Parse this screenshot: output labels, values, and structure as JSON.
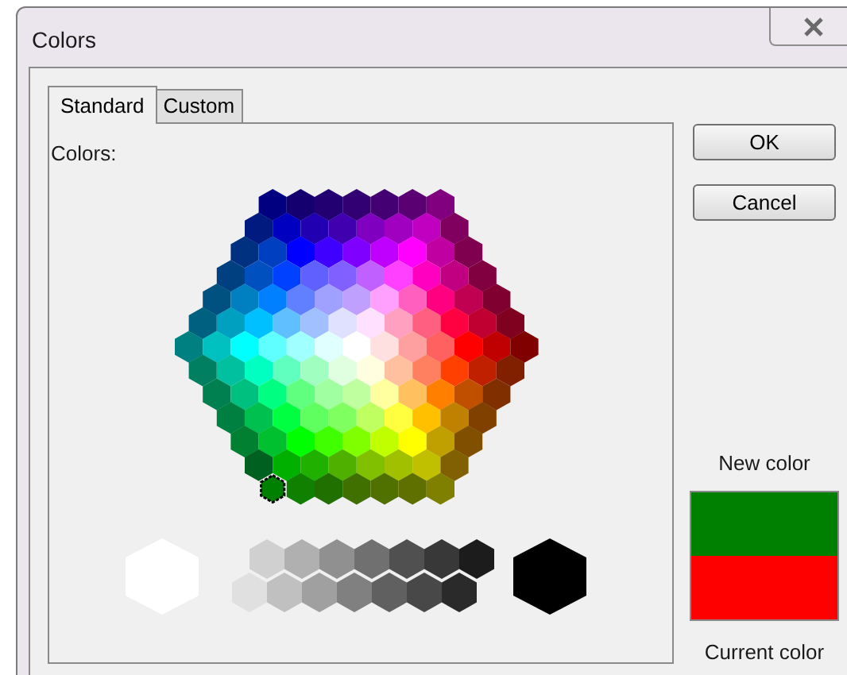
{
  "window": {
    "title": "Colors"
  },
  "tabs": [
    {
      "label": "Standard",
      "selected": true
    },
    {
      "label": "Custom",
      "selected": false
    }
  ],
  "colors_label": "Colors:",
  "palette": [
    [
      {
        "color": "#000080",
        "selected": false
      },
      {
        "color": "#14006e",
        "selected": false
      },
      {
        "color": "#220072",
        "selected": false
      },
      {
        "color": "#330073",
        "selected": false
      },
      {
        "color": "#440073",
        "selected": false
      },
      {
        "color": "#5a0073",
        "selected": false
      },
      {
        "color": "#800080",
        "selected": false
      }
    ],
    [
      {
        "color": "#001a80",
        "selected": false
      },
      {
        "color": "#0000c0",
        "selected": false
      },
      {
        "color": "#2000b0",
        "selected": false
      },
      {
        "color": "#4000b0",
        "selected": false
      },
      {
        "color": "#8000c0",
        "selected": false
      },
      {
        "color": "#a000c0",
        "selected": false
      },
      {
        "color": "#c000c0",
        "selected": false
      },
      {
        "color": "#800060",
        "selected": false
      }
    ],
    [
      {
        "color": "#003080",
        "selected": false
      },
      {
        "color": "#0040c0",
        "selected": false
      },
      {
        "color": "#0000ff",
        "selected": false
      },
      {
        "color": "#4000ff",
        "selected": false
      },
      {
        "color": "#8000ff",
        "selected": false
      },
      {
        "color": "#c000ff",
        "selected": false
      },
      {
        "color": "#ff00ff",
        "selected": false
      },
      {
        "color": "#c000a0",
        "selected": false
      },
      {
        "color": "#800050",
        "selected": false
      }
    ],
    [
      {
        "color": "#004080",
        "selected": false
      },
      {
        "color": "#0050c0",
        "selected": false
      },
      {
        "color": "#0040ff",
        "selected": false
      },
      {
        "color": "#6060ff",
        "selected": false
      },
      {
        "color": "#8060ff",
        "selected": false
      },
      {
        "color": "#c060ff",
        "selected": false
      },
      {
        "color": "#ff40ff",
        "selected": false
      },
      {
        "color": "#ff00c0",
        "selected": false
      },
      {
        "color": "#c00080",
        "selected": false
      },
      {
        "color": "#800040",
        "selected": false
      }
    ],
    [
      {
        "color": "#005080",
        "selected": false
      },
      {
        "color": "#0080c0",
        "selected": false
      },
      {
        "color": "#0080ff",
        "selected": false
      },
      {
        "color": "#6080ff",
        "selected": false
      },
      {
        "color": "#a0a0ff",
        "selected": false
      },
      {
        "color": "#c0a0ff",
        "selected": false
      },
      {
        "color": "#ffa0ff",
        "selected": false
      },
      {
        "color": "#ff60c0",
        "selected": false
      },
      {
        "color": "#ff0080",
        "selected": false
      },
      {
        "color": "#c00050",
        "selected": false
      },
      {
        "color": "#800030",
        "selected": false
      }
    ],
    [
      {
        "color": "#006080",
        "selected": false
      },
      {
        "color": "#00a0c0",
        "selected": false
      },
      {
        "color": "#00c0ff",
        "selected": false
      },
      {
        "color": "#60c0ff",
        "selected": false
      },
      {
        "color": "#a0c0ff",
        "selected": false
      },
      {
        "color": "#e0e0ff",
        "selected": false
      },
      {
        "color": "#ffe0ff",
        "selected": false
      },
      {
        "color": "#ffa0c0",
        "selected": false
      },
      {
        "color": "#ff6080",
        "selected": false
      },
      {
        "color": "#ff0040",
        "selected": false
      },
      {
        "color": "#c00030",
        "selected": false
      },
      {
        "color": "#800020",
        "selected": false
      }
    ],
    [
      {
        "color": "#008080",
        "selected": false
      },
      {
        "color": "#00c0c0",
        "selected": false
      },
      {
        "color": "#00ffff",
        "selected": false
      },
      {
        "color": "#60ffff",
        "selected": false
      },
      {
        "color": "#a0ffff",
        "selected": false
      },
      {
        "color": "#e0ffff",
        "selected": false
      },
      {
        "color": "#ffffff",
        "selected": false
      },
      {
        "color": "#ffe0e0",
        "selected": false
      },
      {
        "color": "#ffa0a0",
        "selected": false
      },
      {
        "color": "#ff6060",
        "selected": false
      },
      {
        "color": "#ff0000",
        "selected": false
      },
      {
        "color": "#c00000",
        "selected": false
      },
      {
        "color": "#800000",
        "selected": false
      }
    ],
    [
      {
        "color": "#008060",
        "selected": false
      },
      {
        "color": "#00c0a0",
        "selected": false
      },
      {
        "color": "#00ffc0",
        "selected": false
      },
      {
        "color": "#60ffc0",
        "selected": false
      },
      {
        "color": "#a0ffc0",
        "selected": false
      },
      {
        "color": "#e0ffe0",
        "selected": false
      },
      {
        "color": "#ffffe0",
        "selected": false
      },
      {
        "color": "#ffc0a0",
        "selected": false
      },
      {
        "color": "#ff8060",
        "selected": false
      },
      {
        "color": "#ff4000",
        "selected": false
      },
      {
        "color": "#c02000",
        "selected": false
      },
      {
        "color": "#802000",
        "selected": false
      }
    ],
    [
      {
        "color": "#008050",
        "selected": false
      },
      {
        "color": "#00c080",
        "selected": false
      },
      {
        "color": "#00ff80",
        "selected": false
      },
      {
        "color": "#60ff80",
        "selected": false
      },
      {
        "color": "#a0ffa0",
        "selected": false
      },
      {
        "color": "#c0ffa0",
        "selected": false
      },
      {
        "color": "#ffffa0",
        "selected": false
      },
      {
        "color": "#ffc060",
        "selected": false
      },
      {
        "color": "#ff8000",
        "selected": false
      },
      {
        "color": "#c05000",
        "selected": false
      },
      {
        "color": "#803000",
        "selected": false
      }
    ],
    [
      {
        "color": "#008040",
        "selected": false
      },
      {
        "color": "#00c050",
        "selected": false
      },
      {
        "color": "#00ff40",
        "selected": false
      },
      {
        "color": "#60ff60",
        "selected": false
      },
      {
        "color": "#80ff60",
        "selected": false
      },
      {
        "color": "#c0ff60",
        "selected": false
      },
      {
        "color": "#ffff40",
        "selected": false
      },
      {
        "color": "#ffc000",
        "selected": false
      },
      {
        "color": "#c08000",
        "selected": false
      },
      {
        "color": "#804000",
        "selected": false
      }
    ],
    [
      {
        "color": "#008030",
        "selected": false
      },
      {
        "color": "#00c030",
        "selected": false
      },
      {
        "color": "#00ff00",
        "selected": false
      },
      {
        "color": "#40ff00",
        "selected": false
      },
      {
        "color": "#80ff00",
        "selected": false
      },
      {
        "color": "#c0ff00",
        "selected": false
      },
      {
        "color": "#ffff00",
        "selected": false
      },
      {
        "color": "#c0a000",
        "selected": false
      },
      {
        "color": "#805000",
        "selected": false
      }
    ],
    [
      {
        "color": "#006020",
        "selected": false
      },
      {
        "color": "#00b000",
        "selected": false
      },
      {
        "color": "#20b000",
        "selected": false
      },
      {
        "color": "#50b000",
        "selected": false
      },
      {
        "color": "#80c000",
        "selected": false
      },
      {
        "color": "#a0c000",
        "selected": false
      },
      {
        "color": "#c0c000",
        "selected": false
      },
      {
        "color": "#806000",
        "selected": false
      }
    ],
    [
      {
        "color": "#008000",
        "selected": true
      },
      {
        "color": "#108000",
        "selected": false
      },
      {
        "color": "#207000",
        "selected": false
      },
      {
        "color": "#407000",
        "selected": false
      },
      {
        "color": "#507000",
        "selected": false
      },
      {
        "color": "#607000",
        "selected": false
      },
      {
        "color": "#808000",
        "selected": false
      }
    ]
  ],
  "grays": {
    "white": {
      "color": "#ffffff",
      "selected": false
    },
    "top": [
      {
        "color": "#d0d0d0",
        "selected": false
      },
      {
        "color": "#b0b0b0",
        "selected": false
      },
      {
        "color": "#909090",
        "selected": false
      },
      {
        "color": "#707070",
        "selected": false
      },
      {
        "color": "#505050",
        "selected": false
      },
      {
        "color": "#383838",
        "selected": false
      },
      {
        "color": "#1c1c1c",
        "selected": false
      }
    ],
    "bottom": [
      {
        "color": "#e0e0e0",
        "selected": false
      },
      {
        "color": "#c0c0c0",
        "selected": false
      },
      {
        "color": "#a0a0a0",
        "selected": false
      },
      {
        "color": "#808080",
        "selected": false
      },
      {
        "color": "#606060",
        "selected": false
      },
      {
        "color": "#484848",
        "selected": false
      },
      {
        "color": "#2a2a2a",
        "selected": false
      }
    ],
    "black": {
      "color": "#000000",
      "selected": false
    }
  },
  "buttons": [
    {
      "label": "OK"
    },
    {
      "label": "Cancel"
    }
  ],
  "new_color": {
    "label": "New color",
    "color": "#008000"
  },
  "current_color": {
    "label": "Current color",
    "color": "#ff0000"
  }
}
